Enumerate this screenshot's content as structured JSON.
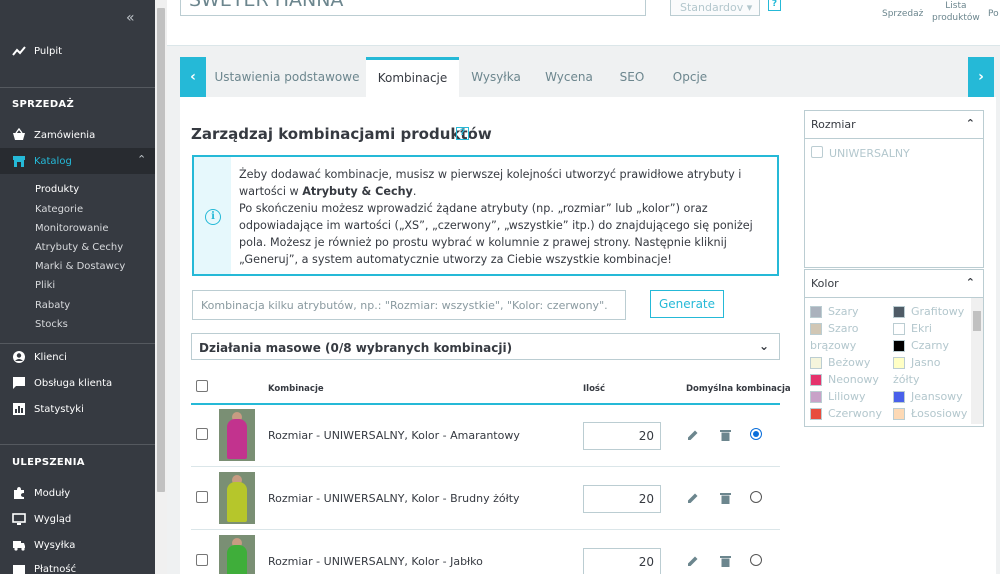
{
  "sidebar": {
    "collapse_icon": "double-chevron-left-icon",
    "dashboard": "Pulpit",
    "section_sell": "SPRZEDAŻ",
    "orders": "Zamówienia",
    "catalog": "Katalog",
    "catalog_sub": [
      "Produkty",
      "Kategorie",
      "Monitorowanie",
      "Atrybuty & Cechy",
      "Marki & Dostawcy",
      "Pliki",
      "Rabaty",
      "Stocks"
    ],
    "customers": "Klienci",
    "customer_service": "Obsługa klienta",
    "stats": "Statystyki",
    "section_improve": "ULEPSZENIA",
    "modules": "Moduły",
    "design": "Wygląd",
    "shipping": "Wysyłka",
    "payment": "Płatność"
  },
  "header": {
    "product_name": "SWETER HANNA",
    "type_select": "Standardov",
    "help": "?",
    "sales_link": "Sprzedaż",
    "product_list_link": [
      "Lista",
      "produktów"
    ],
    "next_link": "Po"
  },
  "tabs": {
    "prev": "‹",
    "next": "›",
    "items": [
      "Ustawienia podstawowe",
      "Kombinacje",
      "Wysyłka",
      "Wycena",
      "SEO",
      "Opcje"
    ]
  },
  "main": {
    "title": "Zarządzaj kombinacjami produktów",
    "help": "?",
    "info_icon": "i",
    "info_p1a": "Żeby dodawać kombinacje, musisz w pierwszej kolejności utworzyć prawidłowe atrybuty i wartości w ",
    "info_p1b": "Atrybuty & Cechy",
    "info_p1c": ".",
    "info_p2": "Po skończeniu możesz wprowadzić żądane atrybuty (np. „rozmiar” lub „kolor”) oraz odpowiadające im wartości („XS”, „czerwony”, „wszystkie” itp.) do znajdującego się poniżej pola. Możesz je również po prostu wybrać w kolumnie z prawej strony. Następnie kliknij „Generuj”, a system automatycznie utworzy za Ciebie wszystkie kombinacje!",
    "combo_placeholder": "Kombinacja kilku atrybutów, np.: \"Rozmiar: wszystkie\", \"Kolor: czerwony\".",
    "generate": "Generate",
    "bulk_actions": "Działania masowe (0/8 wybranych kombinacji)",
    "columns": {
      "combination": "Kombinacje",
      "quantity": "Ilość",
      "default": "Domyślna kombinacja"
    },
    "rows": [
      {
        "name": "Rozmiar - UNIWERSALNY, Kolor - Amarantowy",
        "qty": "20",
        "default": true,
        "color": "#c2338e"
      },
      {
        "name": "Rozmiar - UNIWERSALNY, Kolor - Brudny żółty",
        "qty": "20",
        "default": false,
        "color": "#b6c62b"
      },
      {
        "name": "Rozmiar - UNIWERSALNY, Kolor - Jabłko",
        "qty": "20",
        "default": false,
        "color": "#3fae3a"
      }
    ]
  },
  "right_panel": {
    "size_title": "Rozmiar",
    "size_options": [
      "UNIWERSALNY"
    ],
    "color_title": "Kolor",
    "colors_left": [
      {
        "label": "Szary",
        "hex": "#aab2bd"
      },
      {
        "label": "Szaro",
        "hex": "#d1c7b5"
      },
      {
        "label": "brązowy",
        "hex": ""
      },
      {
        "label": "Beżowy",
        "hex": "#f5f5dc"
      },
      {
        "label": "Neonowy",
        "hex": "#e5336d"
      },
      {
        "label": "Liliowy",
        "hex": "#c8a2c8"
      },
      {
        "label": "Czerwony",
        "hex": "#e84c3d"
      }
    ],
    "colors_right": [
      {
        "label": "Grafitowy",
        "hex": "#4f5b66"
      },
      {
        "label": "Ekri",
        "hex": "#ffffff"
      },
      {
        "label": "Czarny",
        "hex": "#000000"
      },
      {
        "label": "Jasno",
        "hex": "#ffffc5"
      },
      {
        "label": "żółty",
        "hex": ""
      },
      {
        "label": "Jeansowy",
        "hex": "#4860ea"
      },
      {
        "label": "Łososiowy",
        "hex": "#fdd9b5"
      }
    ]
  }
}
